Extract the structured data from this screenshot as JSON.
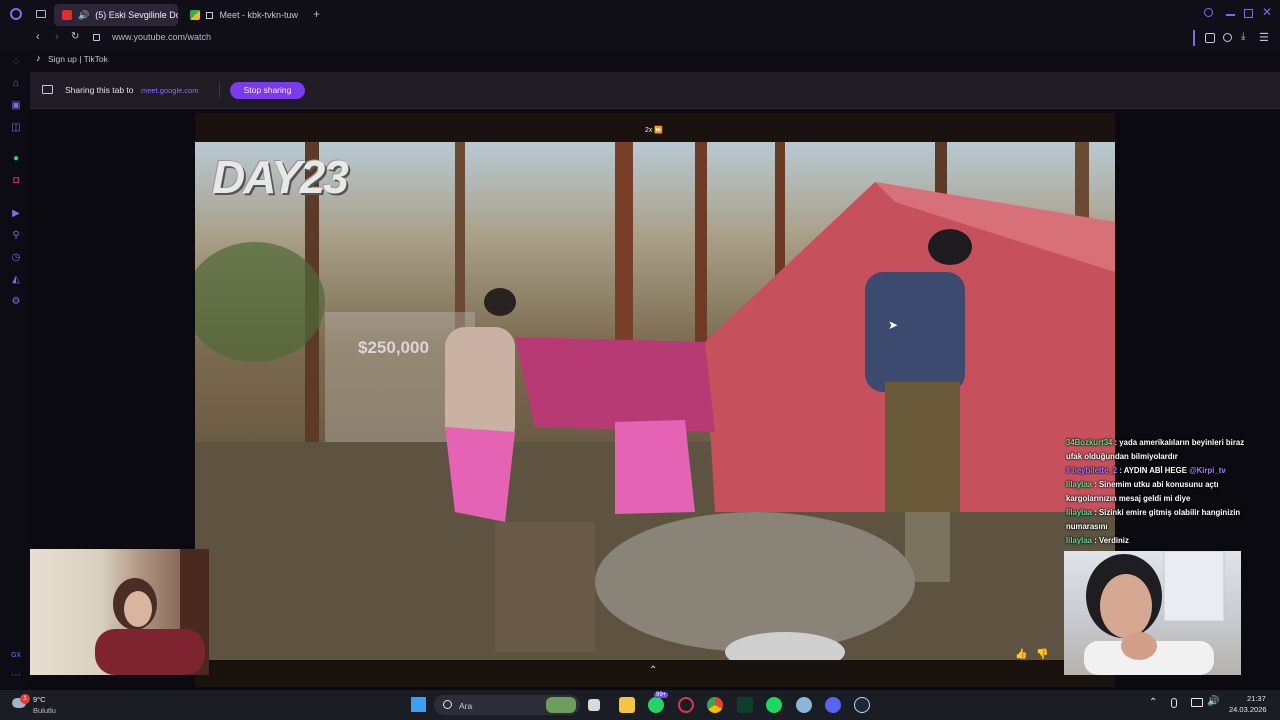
{
  "browser": {
    "tabs": [
      {
        "label": "(5) Eski Sevgilinle Doğ",
        "active": true
      },
      {
        "label": "Meet - kbk-tvkn-tuw",
        "active": false
      }
    ],
    "new_tab_label": "+",
    "url": "www.youtube.com/watch",
    "bookmarks": [
      {
        "label": "Sign up | TikTok"
      }
    ]
  },
  "sharing_bar": {
    "text": "Sharing this tab to",
    "domain": "meet.google.com",
    "stop_button": "Stop sharing"
  },
  "video": {
    "day_title": "DAY23",
    "prize": "$250,000",
    "speed": "2x ⏩"
  },
  "chat": [
    {
      "user": "34Bozkurt34",
      "message": ": yada amerikalıların beyinleri biraz ufak olduğundan bilmiyolardır"
    },
    {
      "user": "heybilette_2",
      "message": ": AYDIN ABİ HEGE",
      "mention": "@Kirpi_tv",
      "purple": true
    },
    {
      "user": "lilaylaa",
      "message": ": Sinemim utku abi konusunu açtı kargolarınızın mesaj geldi mi diye"
    },
    {
      "user": "lilaylaa",
      "message": ": Sizinki emire gitmiş olabilir hanginizin numarasını"
    },
    {
      "user": "lilaylaa",
      "message": ": Verdiniz"
    }
  ],
  "taskbar": {
    "weather_temp": "9°C",
    "weather_desc": "Bulutlu",
    "search_placeholder": "Ara",
    "badge_count": "99+",
    "time": "21:37",
    "date": "24.03.2026",
    "notification_count": "1"
  },
  "colors": {
    "accent": "#7c3aed",
    "chat_user": "#5be08f"
  }
}
